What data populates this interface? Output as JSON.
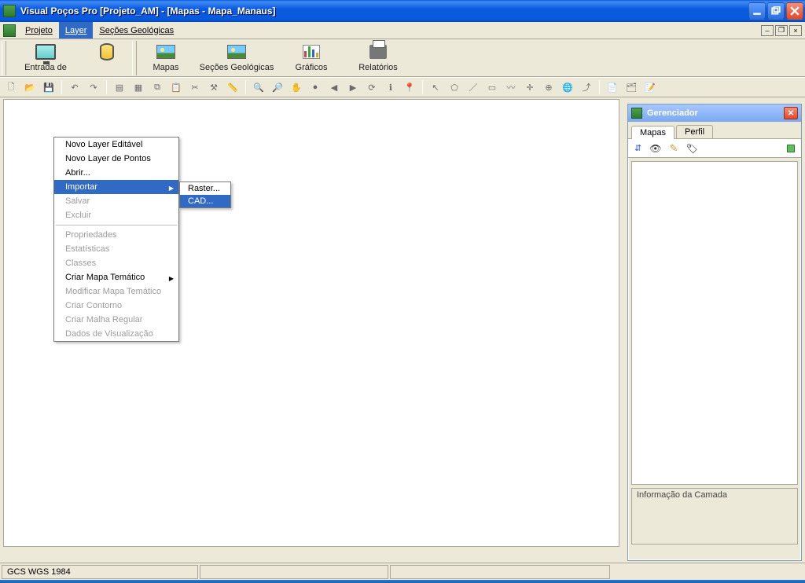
{
  "title": "Visual Poços Pro [Projeto_AM] - [Mapas - Mapa_Manaus]",
  "menubar": {
    "projeto": "Projeto",
    "layer": "Layer",
    "secoes": "Seções Geológicas"
  },
  "toolbar": {
    "entrada": "Entrada de",
    "bd": "",
    "mapas": "Mapas",
    "secoes": "Seções Geológicas",
    "graficos": "Gráficos",
    "relatorios": "Relatórios"
  },
  "layer_menu": {
    "novo_editavel": "Novo Layer Editável",
    "novo_pontos": "Novo Layer de Pontos",
    "abrir": "Abrir...",
    "importar": "Importar",
    "salvar": "Salvar",
    "excluir": "Excluir",
    "propriedades": "Propriedades",
    "estatisticas": "Estatísticas",
    "classes": "Classes",
    "criar_tematico": "Criar Mapa Temático",
    "modificar_tematico": "Modificar Mapa Temático",
    "criar_contorno": "Criar Contorno",
    "criar_malha": "Criar Malha Regular",
    "dados_vis": "Dados de Visualização"
  },
  "importar_submenu": {
    "raster": "Raster...",
    "cad": "CAD..."
  },
  "panel": {
    "title": "Gerenciador",
    "tab_mapas": "Mapas",
    "tab_perfil": "Perfil",
    "info_label": "Informação da Camada"
  },
  "statusbar": {
    "proj": "GCS WGS 1984"
  }
}
